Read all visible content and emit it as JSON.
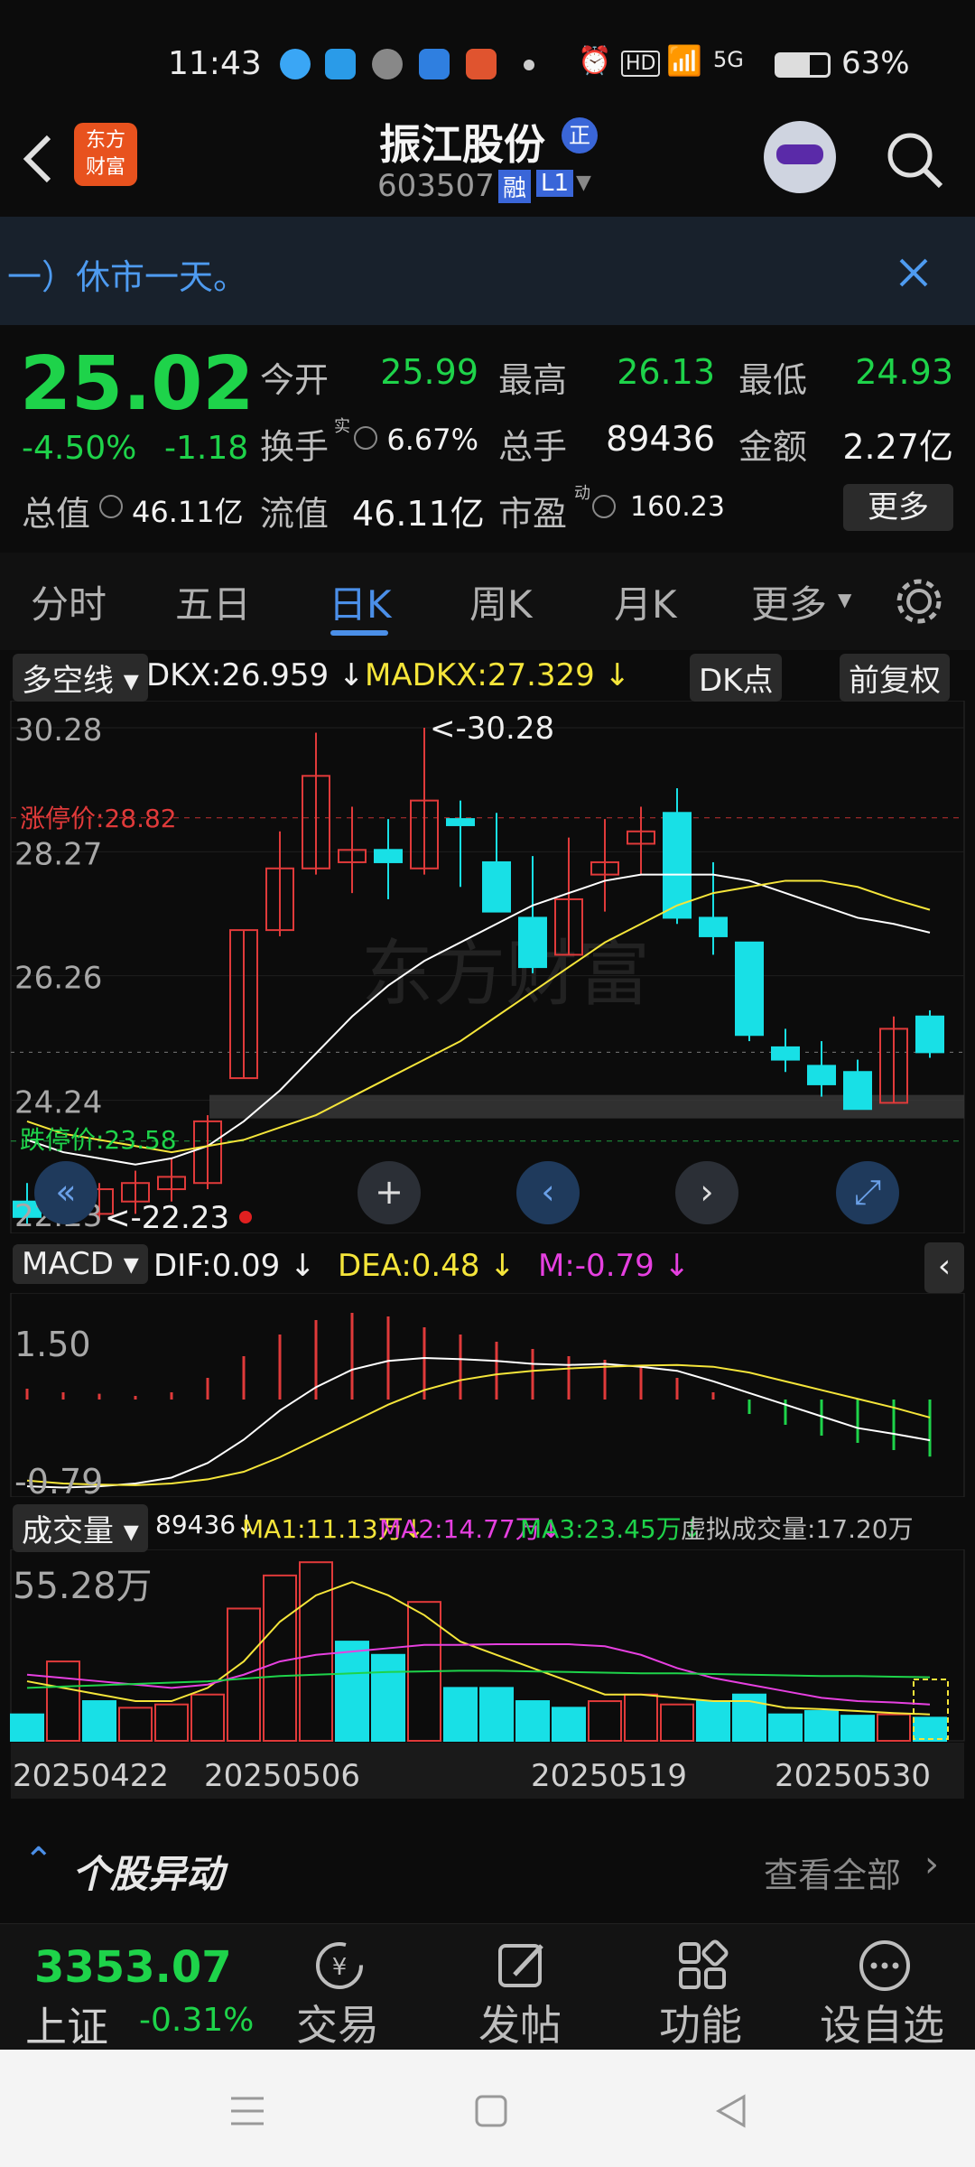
{
  "status_bar": {
    "time": "11:43",
    "battery": "63%",
    "network": "5G",
    "hd": "HD"
  },
  "nav": {
    "logo_line1": "东方",
    "logo_line2": "财富",
    "title": "振江股份",
    "badge": "正",
    "code": "603507",
    "tag_rong": "融",
    "tag_level": "L1"
  },
  "banner": {
    "text": "一）休市一天。"
  },
  "quote": {
    "price": "25.02",
    "change_pct": "-4.50%",
    "change_abs": "-1.18",
    "open_label": "今开",
    "open": "25.99",
    "high_label": "最高",
    "high": "26.13",
    "low_label": "最低",
    "low": "24.93",
    "turnover_label": "换手",
    "turnover_sup": "实",
    "turnover": "6.67%",
    "volume_label": "总手",
    "volume": "89436",
    "amount_label": "金额",
    "amount": "2.27亿",
    "mktcap_label": "总值",
    "mktcap": "46.11亿",
    "float_label": "流值",
    "float_cap": "46.11亿",
    "pe_label": "市盈",
    "pe_sup": "动",
    "pe": "160.23",
    "more_btn": "更多"
  },
  "tabs": {
    "items": [
      "分时",
      "五日",
      "日K",
      "周K",
      "月K",
      "更多"
    ],
    "active": "日K"
  },
  "kline": {
    "indicator": "多空线",
    "dkx": "DKX:26.959",
    "madkx": "MADKX:27.329",
    "dk_btn": "DK点",
    "adjust_btn": "前复权",
    "max_label": "<-30.28",
    "min_label": "<-22.23",
    "limit_up": "涨停价:28.82",
    "limit_down": "跌停价:23.58",
    "y_labels": [
      "30.28",
      "28.27",
      "26.26",
      "24.24",
      "22.23"
    ]
  },
  "macd": {
    "label": "MACD",
    "dif": "DIF:0.09",
    "dea": "DEA:0.48",
    "m": "M:-0.79",
    "y_top": "1.50",
    "y_bottom": "-0.79"
  },
  "volume": {
    "label": "成交量",
    "val": "89436",
    "ma1": "MA1:11.13万",
    "ma2": "MA2:14.77万",
    "ma3": "MA3:23.45万",
    "virtual": "虚拟成交量:17.20万",
    "y_top": "55.28万",
    "dates": [
      "20250422",
      "20250506",
      "20250519",
      "20250530"
    ]
  },
  "section": {
    "title": "个股异动",
    "link": "查看全部"
  },
  "bottom_bar": {
    "index_value": "3353.07",
    "index_name": "上证",
    "index_change": "-0.31%",
    "items": [
      "交易",
      "发帖",
      "功能",
      "设自选"
    ]
  },
  "colors": {
    "up": "#e03a3a",
    "down": "#18e0e6",
    "accent": "#4b8fe8",
    "yellow": "#f5e53a",
    "magenta": "#e640e0",
    "green": "#1ed34a"
  }
}
